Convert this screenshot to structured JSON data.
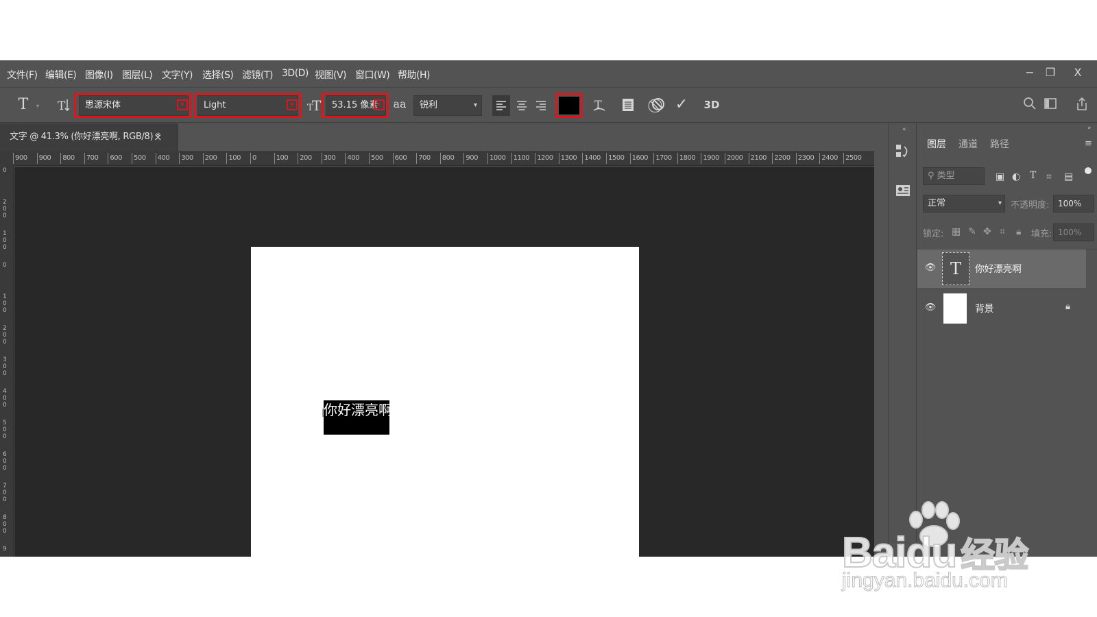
{
  "menu": {
    "items": [
      "文件(F)",
      "编辑(E)",
      "图像(I)",
      "图层(L)",
      "文字(Y)",
      "选择(S)",
      "滤镜(T)",
      "3D(D)",
      "视图(V)",
      "窗口(W)",
      "帮助(H)"
    ],
    "window_controls": {
      "minimize": "−",
      "restore": "❐",
      "close": "X"
    }
  },
  "options": {
    "font_family": "思源宋体",
    "font_style": "Light",
    "font_size": "53.15 像素",
    "antialias_icon": "aa",
    "antialias": "锐利",
    "text_color": "#000000",
    "three_d_label": "3D"
  },
  "document_tab": {
    "title": "文字 @ 41.3% (你好漂亮啊, RGB/8) *",
    "close": "×"
  },
  "ruler": {
    "horizontal": [
      "900",
      "900",
      "800",
      "700",
      "600",
      "500",
      "400",
      "300",
      "200",
      "100",
      "0",
      "100",
      "200",
      "300",
      "400",
      "500",
      "600",
      "700",
      "800",
      "900",
      "1000",
      "1100",
      "1200",
      "1300",
      "1400",
      "1500",
      "1600",
      "1700",
      "1800",
      "1900",
      "2000",
      "2100",
      "2200",
      "2300",
      "2400",
      "2500"
    ],
    "vertical": [
      "0",
      "200",
      "100",
      "0",
      "100",
      "200",
      "300",
      "400",
      "500",
      "600",
      "700",
      "800",
      "9"
    ]
  },
  "canvas": {
    "text": "你好漂亮啊"
  },
  "layers_panel": {
    "tabs": [
      "图层",
      "通道",
      "路径"
    ],
    "filter_placeholder": "类型",
    "blend_mode": "正常",
    "opacity_label": "不透明度:",
    "opacity_value": "100%",
    "lock_label": "锁定:",
    "fill_label": "填充:",
    "fill_value": "100%",
    "layers": [
      {
        "name": "你好漂亮啊",
        "type": "text",
        "thumb": "T"
      },
      {
        "name": "背景",
        "type": "background"
      }
    ]
  },
  "watermark": {
    "logo": "Bai",
    "logo_du": "du",
    "logo_cn": "经验",
    "site": "jingyan.baidu.com"
  }
}
